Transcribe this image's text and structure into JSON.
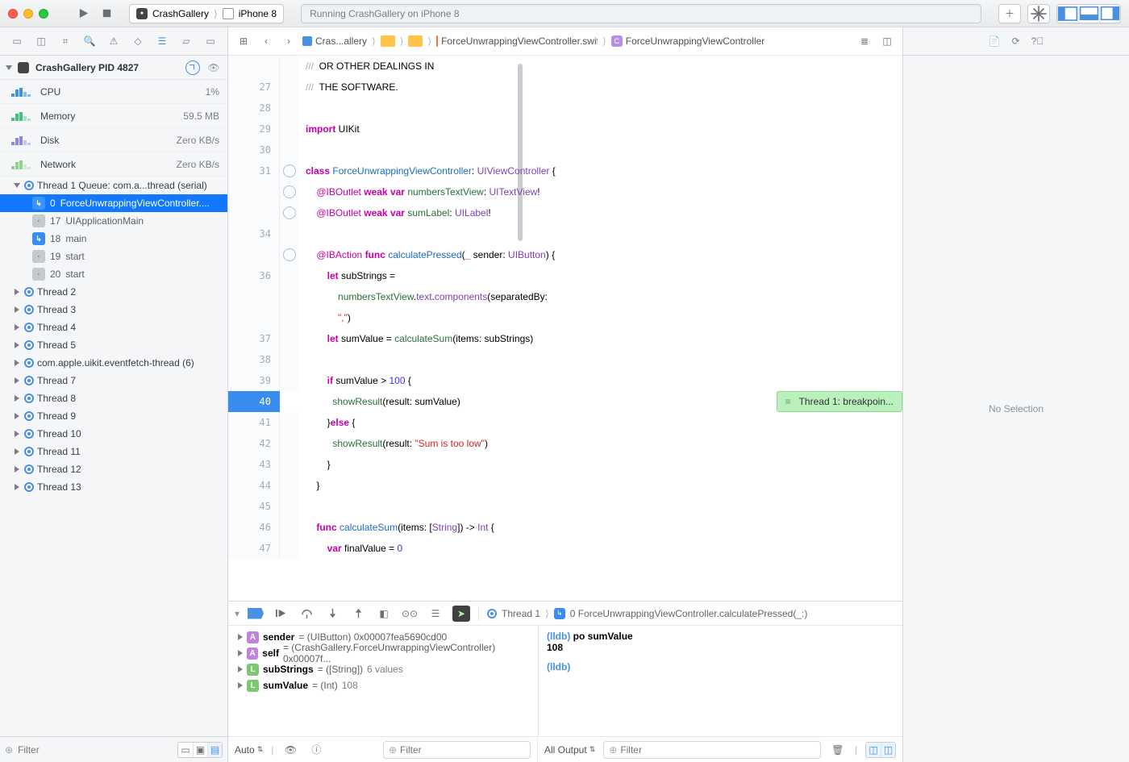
{
  "titlebar": {
    "scheme_app": "CrashGallery",
    "scheme_device": "iPhone 8",
    "activity": "Running CrashGallery on iPhone 8"
  },
  "jump": {
    "project": "Cras...allery",
    "file": "ForceUnwrappingViewController.swift",
    "symbol": "ForceUnwrappingViewController"
  },
  "navigator": {
    "process": "CrashGallery PID 4827",
    "gauges": [
      {
        "label": "CPU",
        "value": "1%"
      },
      {
        "label": "Memory",
        "value": "59.5 MB"
      },
      {
        "label": "Disk",
        "value": "Zero KB/s"
      },
      {
        "label": "Network",
        "value": "Zero KB/s"
      }
    ],
    "thread1_title": "Thread 1 Queue: com.a...thread (serial)",
    "frames": [
      {
        "n": "0",
        "txt": "ForceUnwrappingViewController....",
        "kind": "user",
        "sel": true
      },
      {
        "n": "17",
        "txt": "UIApplicationMain",
        "kind": "sys"
      },
      {
        "n": "18",
        "txt": "main",
        "kind": "user"
      },
      {
        "n": "19",
        "txt": "start",
        "kind": "sys"
      },
      {
        "n": "20",
        "txt": "start",
        "kind": "sys"
      }
    ],
    "threads_rest": [
      "Thread 2",
      "Thread 3",
      "Thread 4",
      "Thread 5",
      "com.apple.uikit.eventfetch-thread (6)",
      "Thread 7",
      "Thread 8",
      "Thread 9",
      "Thread 10",
      "Thread 11",
      "Thread 12",
      "Thread 13"
    ],
    "filter_placeholder": "Filter"
  },
  "editor": {
    "breakpoint_callout": "Thread 1: breakpoin...",
    "string_literal": "\"Sum is too low\"",
    "comma_literal": "\",\"",
    "lines_meta": {
      "numbers": [
        "",
        "27",
        "28",
        "29",
        "30",
        "31",
        "",
        "",
        "34",
        "",
        "36",
        "",
        "37",
        "38",
        "39",
        "40",
        "41",
        "42",
        "43",
        "44",
        "45",
        "46",
        "47"
      ]
    }
  },
  "debug_bar": {
    "thread": "Thread 1",
    "frame": "0 ForceUnwrappingViewController.calculatePressed(_:)"
  },
  "variables": [
    {
      "badge": "A",
      "name": "sender",
      "rest": " = (UIButton) 0x00007fea5690cd00"
    },
    {
      "badge": "A",
      "name": "self",
      "rest": " = (CrashGallery.ForceUnwrappingViewController) 0x00007f..."
    },
    {
      "badge": "L",
      "name": "subStrings",
      "rest": " = ([String]) ",
      "summary": "6 values"
    },
    {
      "badge": "L",
      "name": "sumValue",
      "rest": " = (Int) ",
      "summary": "108"
    }
  ],
  "console": {
    "prompt": "(lldb)",
    "cmd": "po sumValue",
    "out": "108"
  },
  "footer": {
    "auto": "Auto",
    "all_output": "All Output",
    "filter": "Filter"
  },
  "inspector": {
    "empty": "No Selection"
  }
}
